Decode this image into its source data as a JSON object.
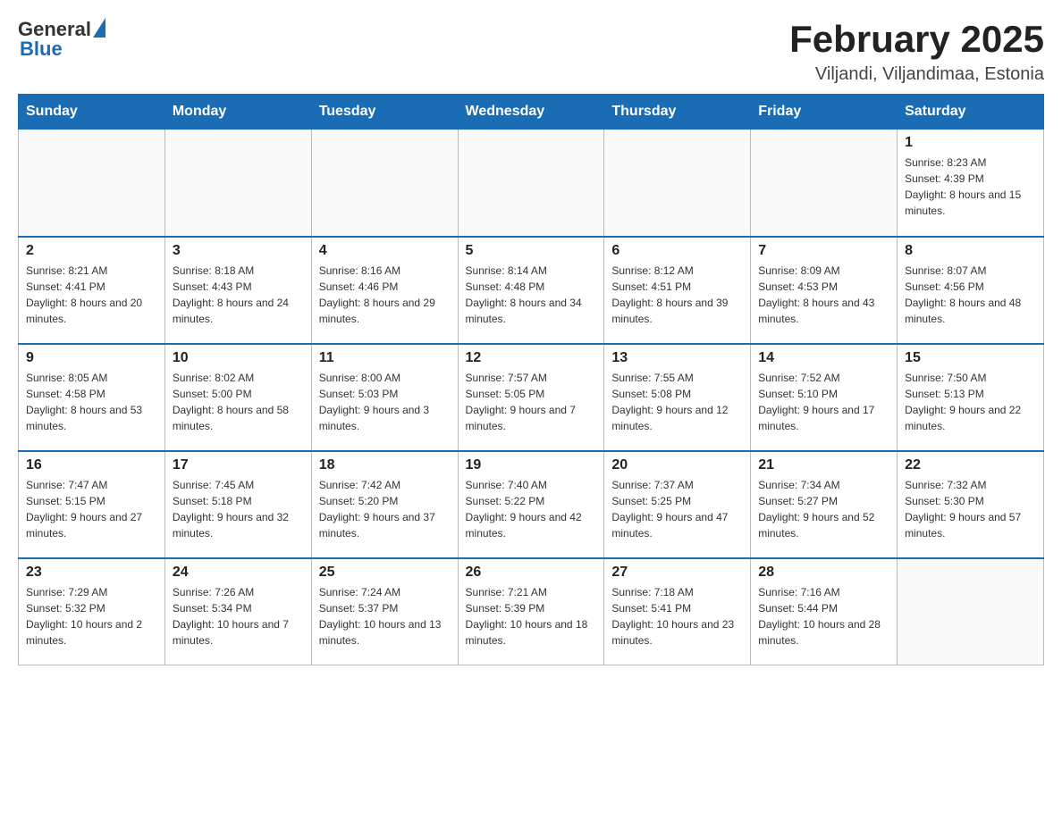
{
  "logo": {
    "text_general": "General",
    "text_blue": "Blue"
  },
  "header": {
    "title": "February 2025",
    "subtitle": "Viljandi, Viljandimaa, Estonia"
  },
  "weekdays": [
    "Sunday",
    "Monday",
    "Tuesday",
    "Wednesday",
    "Thursday",
    "Friday",
    "Saturday"
  ],
  "weeks": [
    [
      {
        "day": "",
        "info": ""
      },
      {
        "day": "",
        "info": ""
      },
      {
        "day": "",
        "info": ""
      },
      {
        "day": "",
        "info": ""
      },
      {
        "day": "",
        "info": ""
      },
      {
        "day": "",
        "info": ""
      },
      {
        "day": "1",
        "info": "Sunrise: 8:23 AM\nSunset: 4:39 PM\nDaylight: 8 hours and 15 minutes."
      }
    ],
    [
      {
        "day": "2",
        "info": "Sunrise: 8:21 AM\nSunset: 4:41 PM\nDaylight: 8 hours and 20 minutes."
      },
      {
        "day": "3",
        "info": "Sunrise: 8:18 AM\nSunset: 4:43 PM\nDaylight: 8 hours and 24 minutes."
      },
      {
        "day": "4",
        "info": "Sunrise: 8:16 AM\nSunset: 4:46 PM\nDaylight: 8 hours and 29 minutes."
      },
      {
        "day": "5",
        "info": "Sunrise: 8:14 AM\nSunset: 4:48 PM\nDaylight: 8 hours and 34 minutes."
      },
      {
        "day": "6",
        "info": "Sunrise: 8:12 AM\nSunset: 4:51 PM\nDaylight: 8 hours and 39 minutes."
      },
      {
        "day": "7",
        "info": "Sunrise: 8:09 AM\nSunset: 4:53 PM\nDaylight: 8 hours and 43 minutes."
      },
      {
        "day": "8",
        "info": "Sunrise: 8:07 AM\nSunset: 4:56 PM\nDaylight: 8 hours and 48 minutes."
      }
    ],
    [
      {
        "day": "9",
        "info": "Sunrise: 8:05 AM\nSunset: 4:58 PM\nDaylight: 8 hours and 53 minutes."
      },
      {
        "day": "10",
        "info": "Sunrise: 8:02 AM\nSunset: 5:00 PM\nDaylight: 8 hours and 58 minutes."
      },
      {
        "day": "11",
        "info": "Sunrise: 8:00 AM\nSunset: 5:03 PM\nDaylight: 9 hours and 3 minutes."
      },
      {
        "day": "12",
        "info": "Sunrise: 7:57 AM\nSunset: 5:05 PM\nDaylight: 9 hours and 7 minutes."
      },
      {
        "day": "13",
        "info": "Sunrise: 7:55 AM\nSunset: 5:08 PM\nDaylight: 9 hours and 12 minutes."
      },
      {
        "day": "14",
        "info": "Sunrise: 7:52 AM\nSunset: 5:10 PM\nDaylight: 9 hours and 17 minutes."
      },
      {
        "day": "15",
        "info": "Sunrise: 7:50 AM\nSunset: 5:13 PM\nDaylight: 9 hours and 22 minutes."
      }
    ],
    [
      {
        "day": "16",
        "info": "Sunrise: 7:47 AM\nSunset: 5:15 PM\nDaylight: 9 hours and 27 minutes."
      },
      {
        "day": "17",
        "info": "Sunrise: 7:45 AM\nSunset: 5:18 PM\nDaylight: 9 hours and 32 minutes."
      },
      {
        "day": "18",
        "info": "Sunrise: 7:42 AM\nSunset: 5:20 PM\nDaylight: 9 hours and 37 minutes."
      },
      {
        "day": "19",
        "info": "Sunrise: 7:40 AM\nSunset: 5:22 PM\nDaylight: 9 hours and 42 minutes."
      },
      {
        "day": "20",
        "info": "Sunrise: 7:37 AM\nSunset: 5:25 PM\nDaylight: 9 hours and 47 minutes."
      },
      {
        "day": "21",
        "info": "Sunrise: 7:34 AM\nSunset: 5:27 PM\nDaylight: 9 hours and 52 minutes."
      },
      {
        "day": "22",
        "info": "Sunrise: 7:32 AM\nSunset: 5:30 PM\nDaylight: 9 hours and 57 minutes."
      }
    ],
    [
      {
        "day": "23",
        "info": "Sunrise: 7:29 AM\nSunset: 5:32 PM\nDaylight: 10 hours and 2 minutes."
      },
      {
        "day": "24",
        "info": "Sunrise: 7:26 AM\nSunset: 5:34 PM\nDaylight: 10 hours and 7 minutes."
      },
      {
        "day": "25",
        "info": "Sunrise: 7:24 AM\nSunset: 5:37 PM\nDaylight: 10 hours and 13 minutes."
      },
      {
        "day": "26",
        "info": "Sunrise: 7:21 AM\nSunset: 5:39 PM\nDaylight: 10 hours and 18 minutes."
      },
      {
        "day": "27",
        "info": "Sunrise: 7:18 AM\nSunset: 5:41 PM\nDaylight: 10 hours and 23 minutes."
      },
      {
        "day": "28",
        "info": "Sunrise: 7:16 AM\nSunset: 5:44 PM\nDaylight: 10 hours and 28 minutes."
      },
      {
        "day": "",
        "info": ""
      }
    ]
  ]
}
